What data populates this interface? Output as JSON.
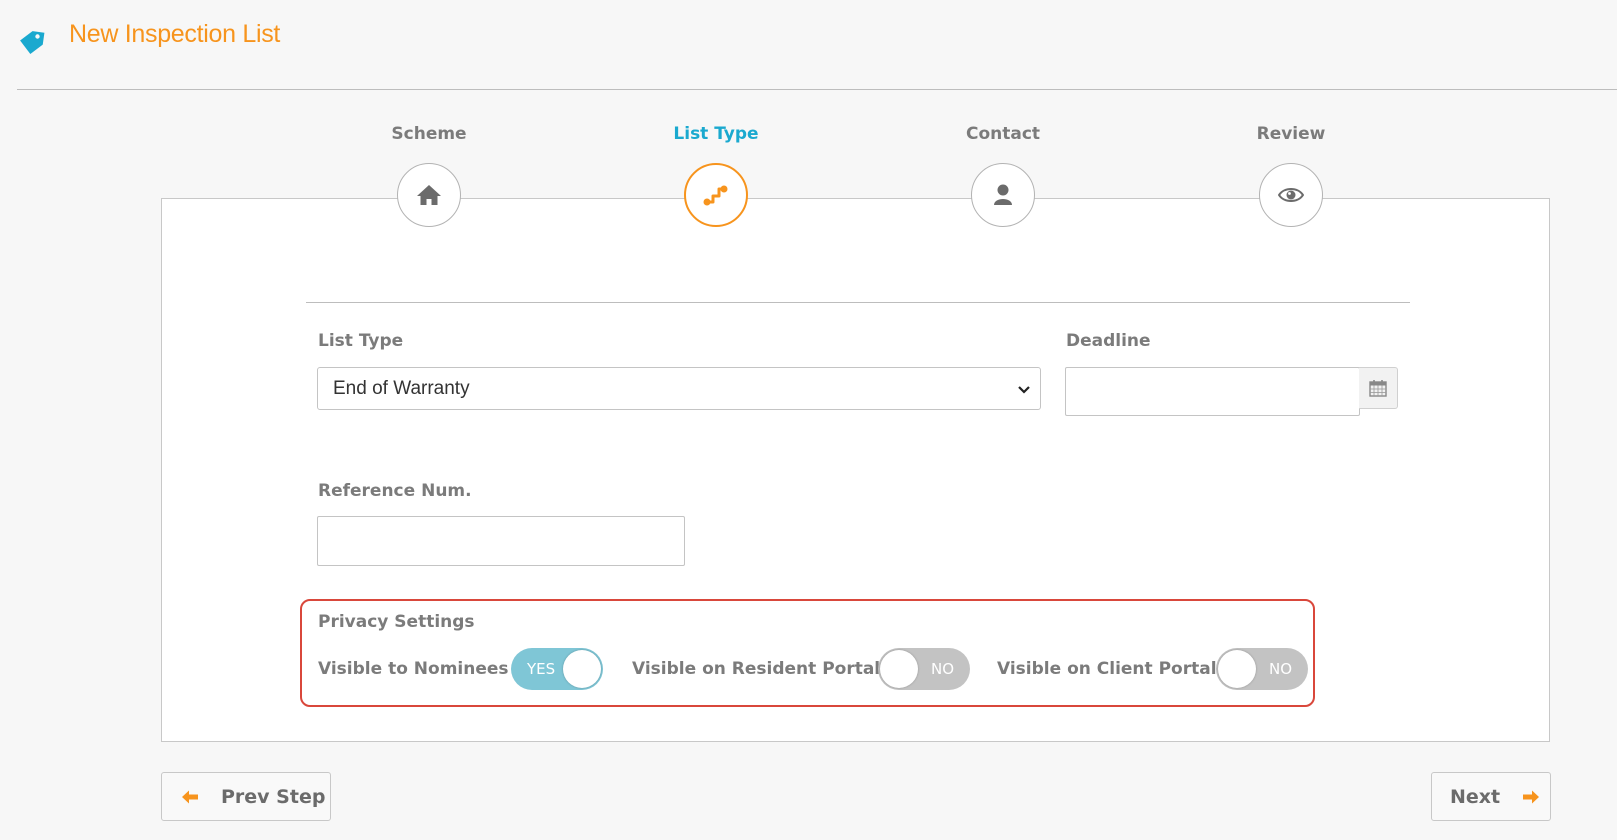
{
  "header": {
    "title": "New Inspection List",
    "icon": "tag-icon",
    "accent_color": "#f7941d",
    "icon_color": "#1aa9cf"
  },
  "wizard": {
    "active_step": "List Type",
    "steps": [
      {
        "label": "Scheme",
        "icon": "home-icon",
        "active": false
      },
      {
        "label": "List Type",
        "icon": "flow-icon",
        "active": true
      },
      {
        "label": "Contact",
        "icon": "user-icon",
        "active": false
      },
      {
        "label": "Review",
        "icon": "eye-icon",
        "active": false
      }
    ]
  },
  "form": {
    "list_type": {
      "label": "List Type",
      "value": "End of Warranty"
    },
    "deadline": {
      "label": "Deadline",
      "value": "",
      "icon": "calendar-icon"
    },
    "reference": {
      "label": "Reference Num.",
      "value": ""
    }
  },
  "privacy": {
    "title": "Privacy Settings",
    "toggles": [
      {
        "label": "Visible to Nominees",
        "state": "YES",
        "on": true
      },
      {
        "label": "Visible on Resident Portal",
        "state": "NO",
        "on": false
      },
      {
        "label": "Visible on Client Portal",
        "state": "NO",
        "on": false
      }
    ]
  },
  "footer": {
    "prev_label": "Prev Step",
    "next_label": "Next",
    "arrow_color": "#f7941d"
  }
}
